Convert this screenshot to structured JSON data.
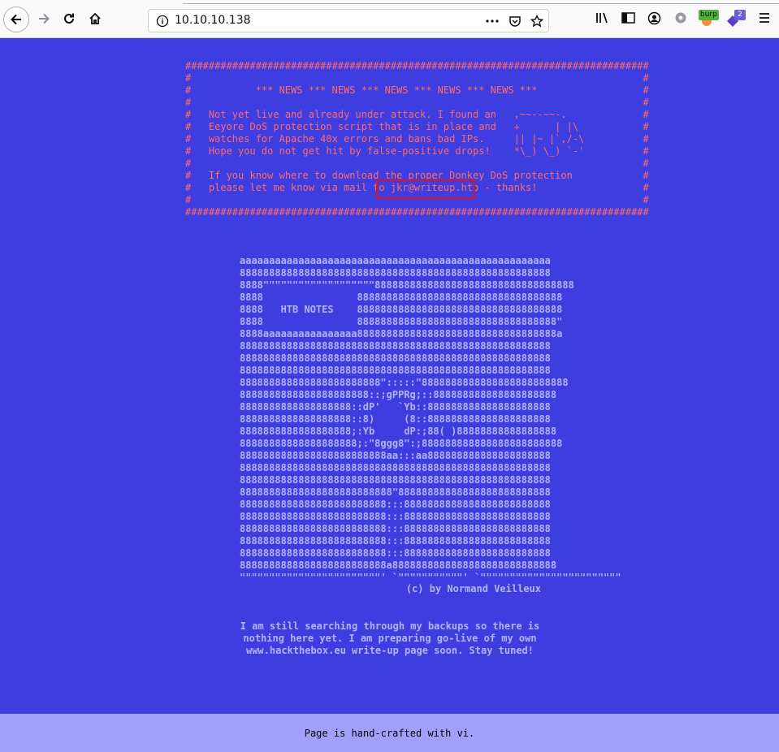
{
  "browser": {
    "url": "10.10.10.138",
    "extensions": {
      "burp_label": "burp",
      "notification_count": "2"
    },
    "icons": [
      "back-arrow-icon",
      "forward-arrow-icon",
      "reload-icon",
      "home-icon",
      "info-icon",
      "more-dots-icon",
      "pocket-icon",
      "bookmark-star-icon",
      "library-icon",
      "sidebar-icon",
      "account-icon",
      "settings-gear-icon",
      "burp-extension-icon",
      "extension-icon",
      "hamburger-menu-icon"
    ]
  },
  "news": {
    "lines": [
      "###############################################################################",
      "#                                                                             #",
      "#           *** NEWS *** NEWS *** NEWS *** NEWS *** NEWS ***                  #",
      "#                                                                             #",
      "#   Not yet live and already under attack. I found an   ,~~--~~-.             #",
      "#   Eeyore DoS protection script that is in place and   +      | |\\           #",
      "#   watches for Apache 40x errors and bans bad IPs.     || |~ |`,/-\\          #",
      "#   Hope you do not get hit by false-positive drops!    *\\_) \\_) `-'          #",
      "#                                                                             #",
      "#   If you know where to download the proper Donkey DoS protection            #",
      "#   please let me know via mail to jkr@writeup.htb - thanks!                  #",
      "#                                                                             #",
      "###############################################################################"
    ],
    "highlighted_email": "jkr@writeup.htb",
    "highlight_color": "#e01020"
  },
  "ascii_art": {
    "lines": [
      "aaaaaaaaaaaaaaaaaaaaaaaaaaaaaaaaaaaaaaaaaaaaaaaaaaaaa",
      "88888888888888888888888888888888888888888888888888888",
      "8888\"\"\"\"\"\"\"\"\"\"\"\"\"\"\"\"\"\"\"8888888888888888888888888888888888",
      "8888                88888888888888888888888888888888888",
      "8888   HTB NOTES    88888888888888888888888888888888888",
      "8888                8888888888888888888888888888888888\"",
      "8888aaaaaaaaaaaaaaaa8888888888888888888888888888888888a",
      "88888888888888888888888888888888888888888888888888888",
      "88888888888888888888888888888888888888888888888888888",
      "88888888888888888888888888888888888888888888888888888",
      "888888888888888888888888\":::::\"8888888888888888888888888",
      "8888888888888888888888::;gPPRg;::888888888888888888888",
      "8888888888888888888::dP'   `Yb::888888888888888888888",
      "8888888888888888888::8)     (8::888888888888888888888",
      "8888888888888888888;:Yb     dP:;88( )88888888888888888",
      "88888888888888888888;:\"8ggg8\":;888888888888888888888888",
      "8888888888888888888888888aa:::aa888888888888888888888",
      "88888888888888888888888888888888888888888888888888888",
      "88888888888888888888888888888888888888888888888888888",
      "88888888888888888888888888\"88888888888888888888888888",
      "8888888888888888888888888:::8888888888888888888888888",
      "8888888888888888888888888:::8888888888888888888888888",
      "8888888888888888888888888:::8888888888888888888888888",
      "8888888888888888888888888:::8888888888888888888888888",
      "8888888888888888888888888:::8888888888888888888888888",
      "8888888888888888888888888a8888888888888888888888888888",
      "\"\"\"\"\"\"\"\"\"\"\"\"\"\"\"\"\"\"\"\"\"\"\"\"' `\"\"\"\"\"\"\"\"\"\"\"' `\"\"\"\"\"\"\"\"\"\"\"\"\"\"\"\"\"\"\"\"\"\"\"\""
    ],
    "credit": "(c) by Normand Veilleux"
  },
  "message": {
    "lines": [
      "I am still searching through my backups so there is",
      "nothing here yet. I am preparing go-live of my own",
      "www.hackthebox.eu write-up page soon. Stay tuned!"
    ]
  },
  "footer": {
    "text": "Page is hand-crafted with vi."
  },
  "colors": {
    "background": "#3e3ee0",
    "news_text": "#ff6a6a",
    "ascii_text": "#b3b3ff",
    "footer_bg": "#a0a0fa"
  }
}
